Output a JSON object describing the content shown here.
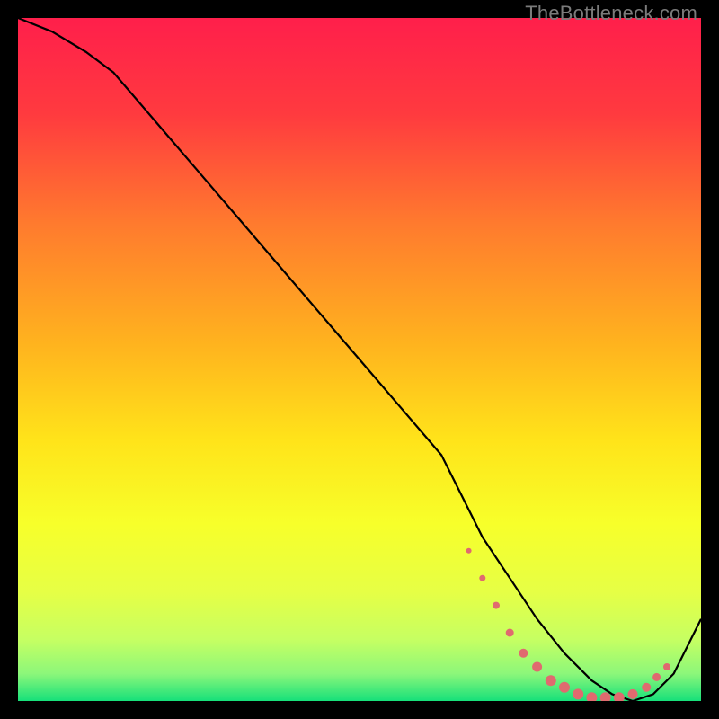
{
  "watermark": "TheBottleneck.com",
  "chart_data": {
    "type": "line",
    "title": "",
    "xlabel": "",
    "ylabel": "",
    "xlim": [
      0,
      100
    ],
    "ylim": [
      0,
      100
    ],
    "background_gradient": {
      "top_color": "#ff1f4b",
      "mid_colors": [
        "#ff7a2e",
        "#ffd000",
        "#f7ff2a",
        "#d6ff60"
      ],
      "bottom_color": "#16e07a"
    },
    "series": [
      {
        "name": "bottleneck-curve",
        "x": [
          0,
          5,
          10,
          14,
          20,
          26,
          32,
          38,
          44,
          50,
          56,
          62,
          65,
          68,
          72,
          76,
          80,
          84,
          87,
          90,
          93,
          96,
          100
        ],
        "y": [
          100,
          98,
          95,
          92,
          85,
          78,
          71,
          64,
          57,
          50,
          43,
          36,
          30,
          24,
          18,
          12,
          7,
          3,
          1,
          0,
          1,
          4,
          12
        ],
        "stroke": "#000000",
        "stroke_width": 2.2
      }
    ],
    "markers": {
      "name": "highlight-dots",
      "color": "#e06a6f",
      "radius_profile": "variable",
      "points": [
        {
          "x": 66,
          "y": 22,
          "r": 3
        },
        {
          "x": 68,
          "y": 18,
          "r": 3.5
        },
        {
          "x": 70,
          "y": 14,
          "r": 4
        },
        {
          "x": 72,
          "y": 10,
          "r": 4.5
        },
        {
          "x": 74,
          "y": 7,
          "r": 5
        },
        {
          "x": 76,
          "y": 5,
          "r": 5.5
        },
        {
          "x": 78,
          "y": 3,
          "r": 6
        },
        {
          "x": 80,
          "y": 2,
          "r": 6
        },
        {
          "x": 82,
          "y": 1,
          "r": 6
        },
        {
          "x": 84,
          "y": 0.5,
          "r": 6
        },
        {
          "x": 86,
          "y": 0.5,
          "r": 6
        },
        {
          "x": 88,
          "y": 0.5,
          "r": 6
        },
        {
          "x": 90,
          "y": 1,
          "r": 5.5
        },
        {
          "x": 92,
          "y": 2,
          "r": 5
        },
        {
          "x": 93.5,
          "y": 3.5,
          "r": 4.5
        },
        {
          "x": 95,
          "y": 5,
          "r": 4
        }
      ]
    }
  }
}
